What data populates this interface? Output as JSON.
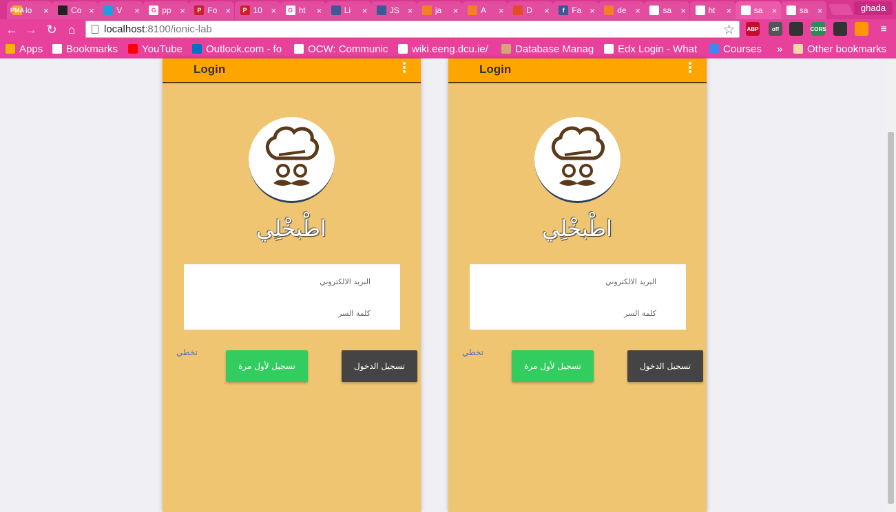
{
  "browser": {
    "tabs": [
      {
        "title": "lo",
        "favicon_color": "#f5a623",
        "favicon_text": "PMA"
      },
      {
        "title": "Co",
        "favicon_color": "#222222",
        "favicon_text": ""
      },
      {
        "title": "V",
        "favicon_color": "#1ba1e2",
        "favicon_text": ""
      },
      {
        "title": "pp",
        "favicon_color": "#ffffff",
        "favicon_text": "G"
      },
      {
        "title": "Fo",
        "favicon_color": "#cb2027",
        "favicon_text": "P"
      },
      {
        "title": "10",
        "favicon_color": "#cb2027",
        "favicon_text": "P"
      },
      {
        "title": "ht",
        "favicon_color": "#ffffff",
        "favicon_text": "G"
      },
      {
        "title": "Li",
        "favicon_color": "#3d5a98",
        "favicon_text": ""
      },
      {
        "title": "JS",
        "favicon_color": "#3d5a98",
        "favicon_text": ""
      },
      {
        "title": "ja",
        "favicon_color": "#f48024",
        "favicon_text": ""
      },
      {
        "title": "A",
        "favicon_color": "#f48024",
        "favicon_text": ""
      },
      {
        "title": "D",
        "favicon_color": "#e34c26",
        "favicon_text": ""
      },
      {
        "title": "Fa",
        "favicon_color": "#3b5998",
        "favicon_text": "f"
      },
      {
        "title": "de",
        "favicon_color": "#f48024",
        "favicon_text": ""
      },
      {
        "title": "sa",
        "favicon_color": "#ffffff",
        "favicon_text": ""
      },
      {
        "title": "ht",
        "favicon_color": "#ffffff",
        "favicon_text": ""
      },
      {
        "title": "sa",
        "favicon_color": "#ffffff",
        "favicon_text": "",
        "active": true
      },
      {
        "title": "sa",
        "favicon_color": "#ffffff",
        "favicon_text": ""
      }
    ],
    "profile_name": "ghada",
    "url_host": "localhost",
    "url_path": ":8100/ionic-lab",
    "extensions": [
      {
        "name": "adblock",
        "label": "ABP",
        "color": "#c70d2c"
      },
      {
        "name": "extension-off",
        "label": "off",
        "color": "#555555"
      },
      {
        "name": "cast",
        "label": "",
        "color": "#333333"
      },
      {
        "name": "cors",
        "label": "CORS",
        "color": "#2e8b57"
      },
      {
        "name": "record",
        "label": "",
        "color": "#333333"
      },
      {
        "name": "color-picker",
        "label": "",
        "color": "#ff9800"
      }
    ],
    "bookmarks": [
      {
        "label": "Apps",
        "color": "#f4b400"
      },
      {
        "label": "Bookmarks",
        "color": "#ffffff"
      },
      {
        "label": "YouTube",
        "color": "#ff0000"
      },
      {
        "label": "Outlook.com - fo",
        "color": "#0072c6"
      },
      {
        "label": "OCW: Communic",
        "color": "#ffffff"
      },
      {
        "label": "wiki.eeng.dcu.ie/",
        "color": "#ffffff"
      },
      {
        "label": "Database Manag",
        "color": "#d2a679"
      },
      {
        "label": "Edx Login - What",
        "color": "#ffffff"
      },
      {
        "label": "Courses",
        "color": "#4285f4"
      }
    ],
    "bookmarks_overflow": "»",
    "other_bookmarks": "Other bookmarks"
  },
  "phones": [
    {
      "header_title": "Login",
      "app_name": "اطْبخْلِي",
      "email_placeholder": "البريد الالكتروني",
      "password_placeholder": "كلمة السر",
      "skip_label": "تخطي",
      "signup_label": "تسجيل لأول مرة",
      "login_label": "تسجيل الدخول"
    },
    {
      "header_title": "Login",
      "app_name": "اطْبخْلِي",
      "email_placeholder": "البريد الالكتروني",
      "password_placeholder": "كلمة السر",
      "skip_label": "تخطي",
      "signup_label": "تسجيل لأول مرة",
      "login_label": "تسجيل الدخول"
    }
  ],
  "colors": {
    "chrome_pink": "#e8419c",
    "header_orange": "#ffa500",
    "content_bg": "#f0c572",
    "signup_green": "#33cd5f",
    "login_dark": "#444444",
    "skip_link": "#4a77b5"
  }
}
